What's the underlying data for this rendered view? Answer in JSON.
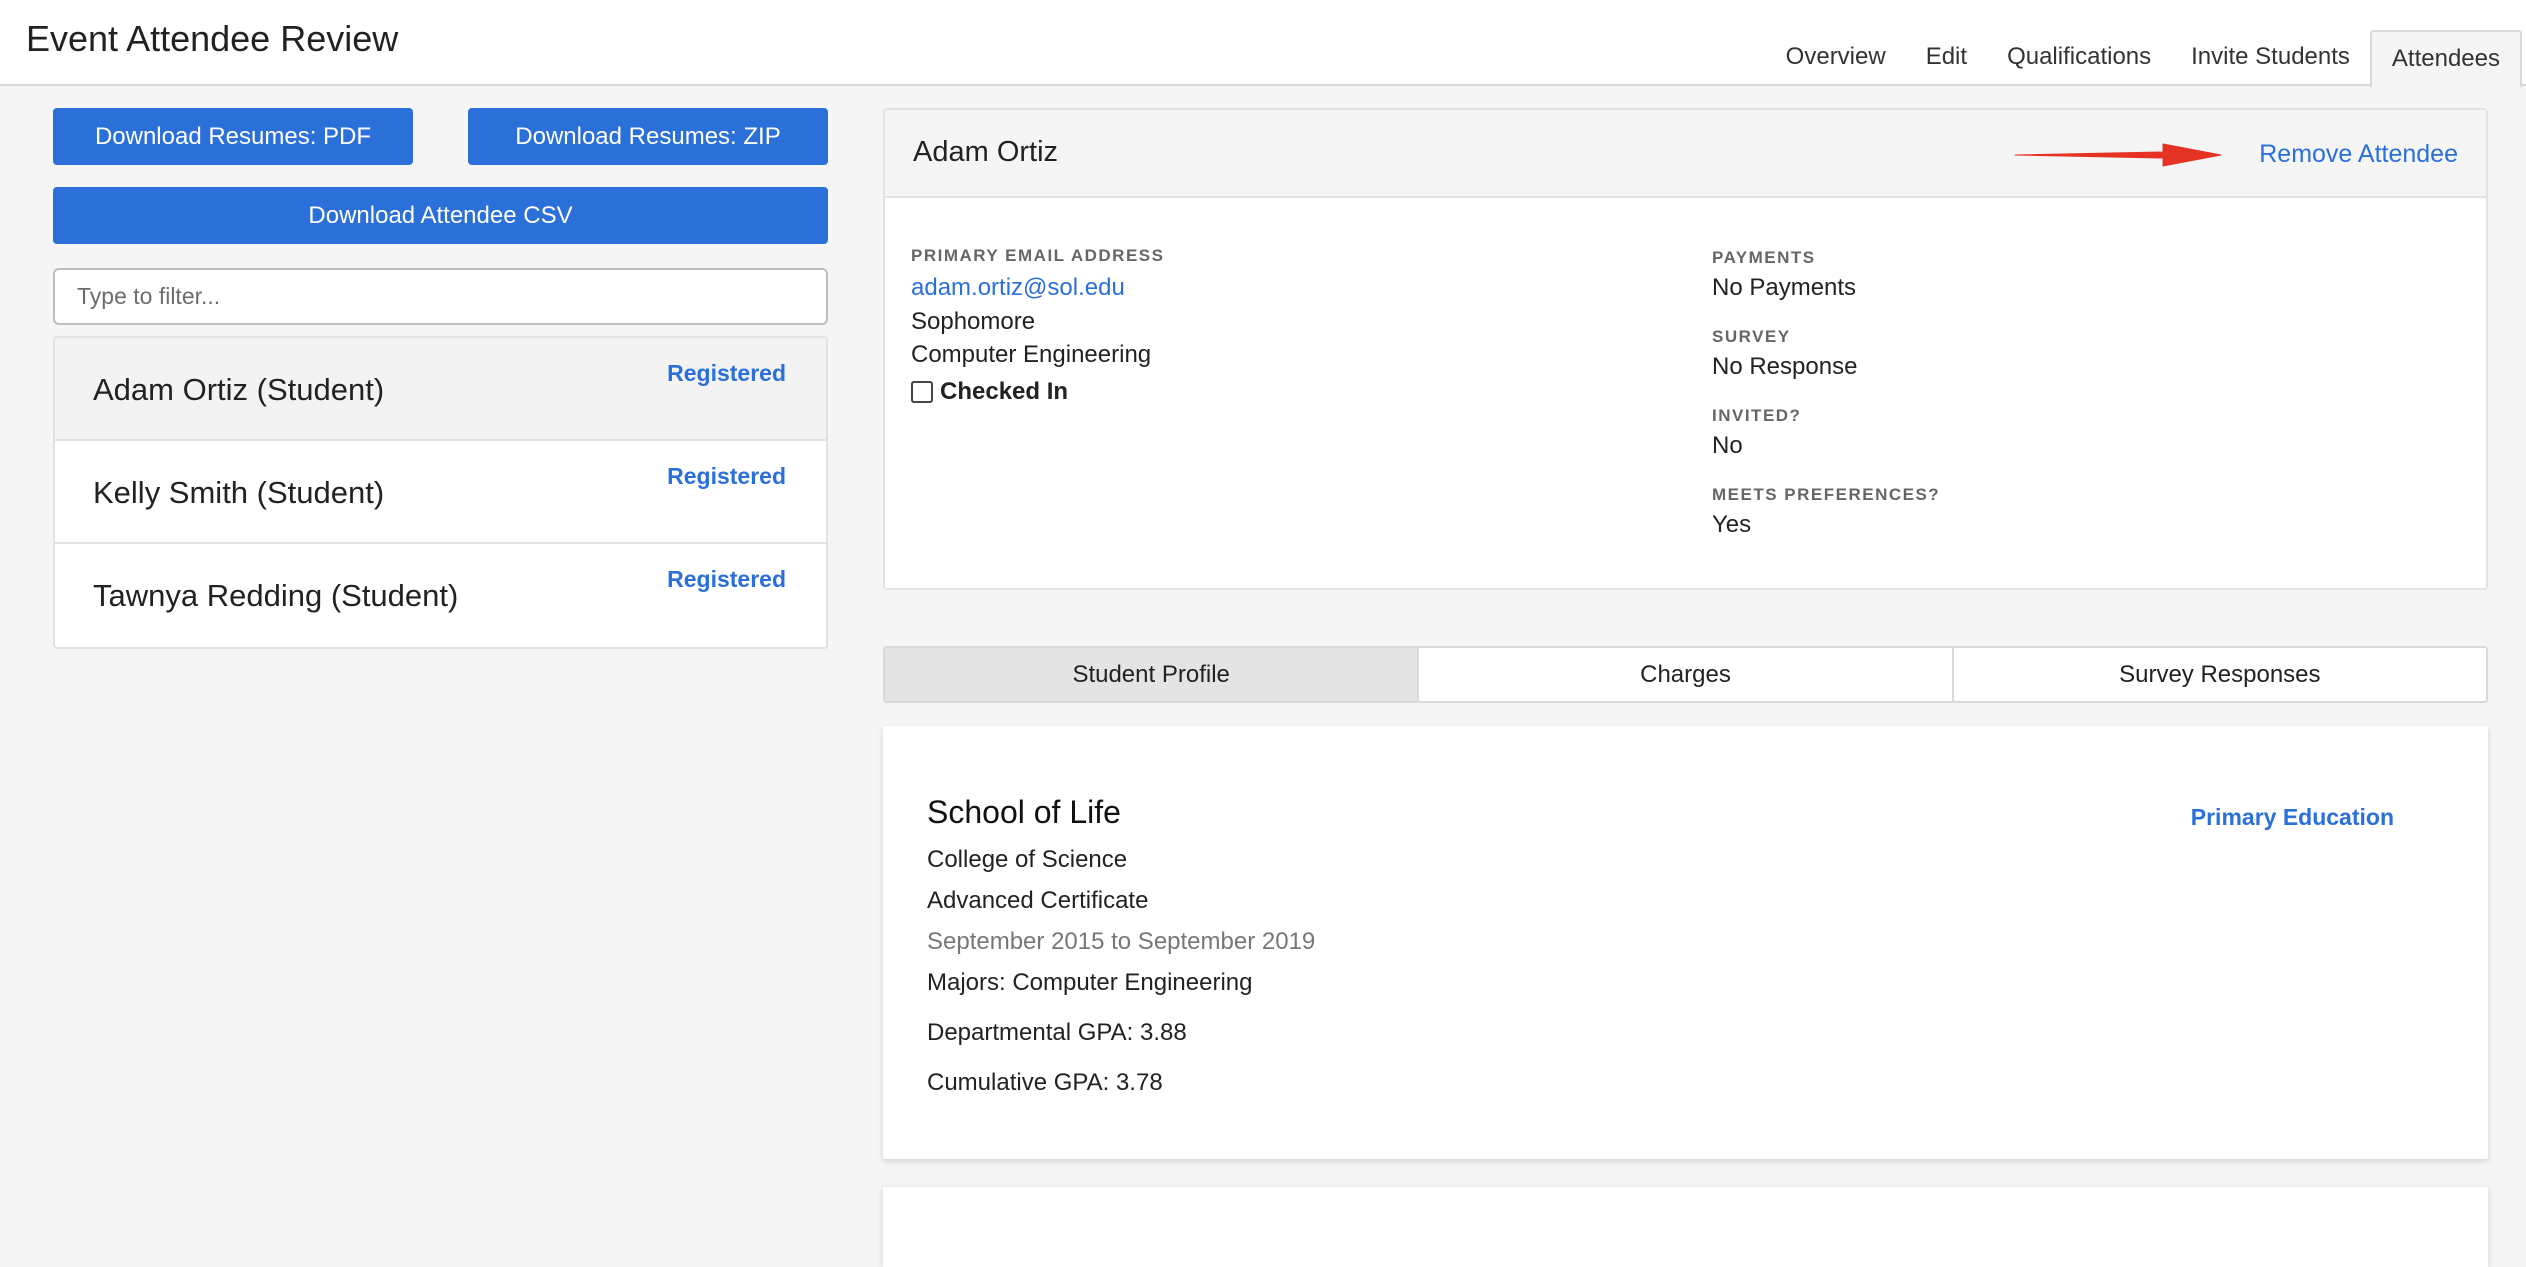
{
  "header": {
    "title": "Event Attendee Review",
    "tabs": [
      "Overview",
      "Edit",
      "Qualifications",
      "Invite Students",
      "Attendees"
    ],
    "active_tab": "Attendees"
  },
  "sidebar": {
    "download_pdf": "Download Resumes: PDF",
    "download_zip": "Download Resumes: ZIP",
    "download_csv": "Download Attendee CSV",
    "filter_placeholder": "Type to filter...",
    "filter_value": "",
    "attendees": [
      {
        "name": "Adam Ortiz (Student)",
        "status": "Registered",
        "selected": true
      },
      {
        "name": "Kelly Smith (Student)",
        "status": "Registered",
        "selected": false
      },
      {
        "name": "Tawnya Redding (Student)",
        "status": "Registered",
        "selected": false
      }
    ]
  },
  "detail": {
    "name": "Adam Ortiz",
    "remove_label": "Remove Attendee",
    "email_label": "PRIMARY EMAIL ADDRESS",
    "email": "adam.ortiz@sol.edu",
    "year": "Sophomore",
    "major": "Computer Engineering",
    "checked_in_label": "Checked In",
    "checked_in": false,
    "payments_label": "PAYMENTS",
    "payments": "No Payments",
    "survey_label": "SURVEY",
    "survey": "No Response",
    "invited_label": "INVITED?",
    "invited": "No",
    "meets_label": "MEETS PREFERENCES?",
    "meets": "Yes"
  },
  "subtabs": {
    "items": [
      "Student Profile",
      "Charges",
      "Survey Responses"
    ],
    "active": "Student Profile"
  },
  "education": {
    "school": "School of Life",
    "primary_label": "Primary Education",
    "college": "College of Science",
    "degree": "Advanced Certificate",
    "dates": "September 2015 to September 2019",
    "majors": "Majors: Computer Engineering",
    "dept_gpa": "Departmental GPA: 3.88",
    "cum_gpa": "Cumulative GPA: 3.78"
  },
  "colors": {
    "accent": "#2b6fd8",
    "arrow": "#e53323",
    "background": "#f5f5f5"
  }
}
